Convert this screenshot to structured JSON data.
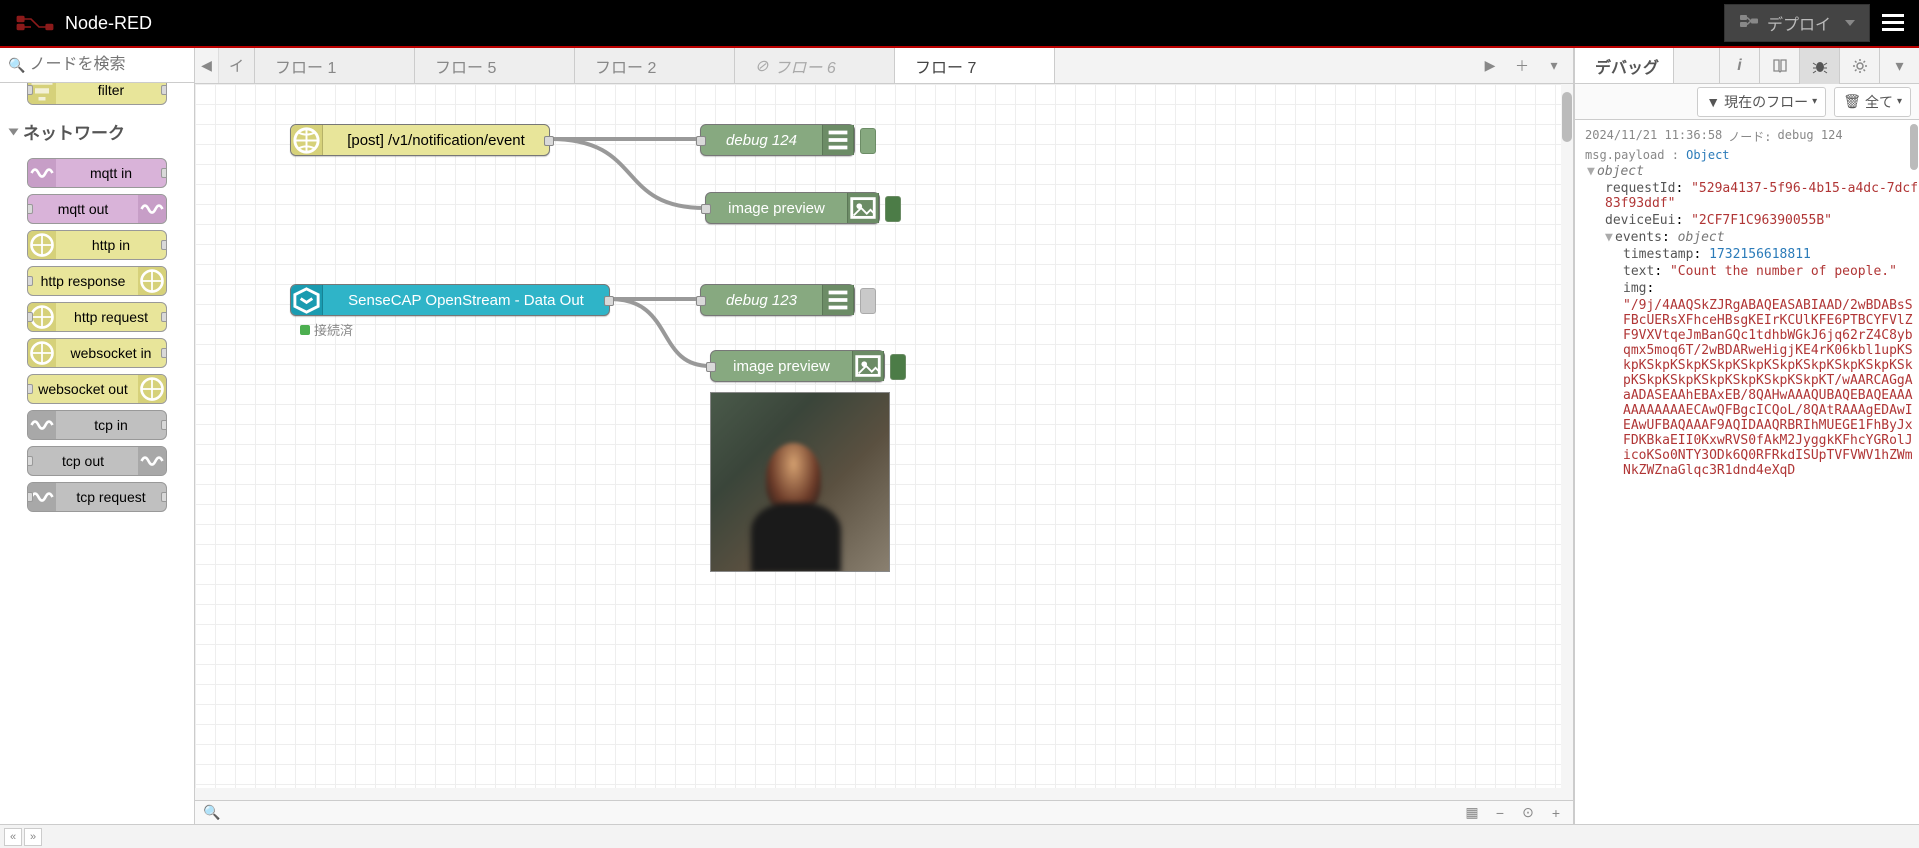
{
  "header": {
    "title": "Node-RED",
    "deploy_label": "デプロイ"
  },
  "palette": {
    "search_placeholder": "ノードを検索",
    "visible_top_item": "filter",
    "category": "ネットワーク",
    "nodes": [
      {
        "label": "mqtt in",
        "style": "purple",
        "in": false,
        "out": true,
        "icon": "wave"
      },
      {
        "label": "mqtt out",
        "style": "purple",
        "in": true,
        "out": false,
        "icon": "wave"
      },
      {
        "label": "http in",
        "style": "yellow",
        "in": false,
        "out": true,
        "icon": "globe"
      },
      {
        "label": "http response",
        "style": "yellow",
        "in": true,
        "out": false,
        "icon": "globe"
      },
      {
        "label": "http request",
        "style": "yellow",
        "in": true,
        "out": true,
        "icon": "globe"
      },
      {
        "label": "websocket in",
        "style": "yellow",
        "in": false,
        "out": true,
        "icon": "globe"
      },
      {
        "label": "websocket out",
        "style": "yellow",
        "in": true,
        "out": false,
        "icon": "globe"
      },
      {
        "label": "tcp in",
        "style": "grey",
        "in": false,
        "out": true,
        "icon": "wave"
      },
      {
        "label": "tcp out",
        "style": "grey",
        "in": true,
        "out": false,
        "icon": "wave"
      },
      {
        "label": "tcp request",
        "style": "grey",
        "in": true,
        "out": true,
        "icon": "wave"
      }
    ]
  },
  "workspace": {
    "truncated_tab": "イ",
    "tabs": [
      {
        "label": "フロー 1",
        "active": false
      },
      {
        "label": "フロー 5",
        "active": false
      },
      {
        "label": "フロー 2",
        "active": false
      },
      {
        "label": "フロー 6",
        "active": false,
        "disabled": true
      },
      {
        "label": "フロー 7",
        "active": true
      }
    ],
    "nodes": {
      "http_in": {
        "label": "[post] /v1/notification/event"
      },
      "debug124": {
        "label": "debug 124"
      },
      "image_preview1": {
        "label": "image preview"
      },
      "sensecap": {
        "label": "SenseCAP OpenStream - Data Out",
        "status": "接続済"
      },
      "debug123": {
        "label": "debug 123"
      },
      "image_preview2": {
        "label": "image preview"
      }
    }
  },
  "debug": {
    "tab_label": "デバッグ",
    "filter_label": "現在のフロー",
    "clear_label": "全て",
    "message": {
      "timestamp": "2024/11/21 11:36:58",
      "node_prefix": "ノード:",
      "node": "debug 124",
      "path": "msg.payload : Object",
      "root_type": "object",
      "requestId": "\"529a4137-5f96-4b15-a4dc-7dcf83f93ddf\"",
      "deviceEui": "\"2CF7F1C96390055B\"",
      "events_type": "object",
      "events_timestamp": "1732156618811",
      "events_text": "\"Count the number of people.\"",
      "events_img": "\"/9j/4AAQSkZJRgABAQEASABIAAD/2wBDABsSFBcUERsXFhceHBsgKEIrKCUlKFE6PTBCYFVlZF9VXVtqeJmBanGQc1tdhbWGkJ6jq62rZ4C8ybqmx5moq6T/2wBDARweHigjKE4rK06kbl1upKSkpKSkpKSkpKSkpKSkpKSkpKSkpKSkpKSkpKSkpKSkpKSkpKSkpKSkpKSkpKSkpKT/wAARCAGgAaADASEAAhEBAxEB/8QAHwAAAQUBAQEBAQEAAAAAAAAAAAECAwQFBgcICQoL/8QAtRAAAgEDAwIEAwUFBAQAAAF9AQIDAAQRBRIhMUEGE1FhByJxFDKBkaEII0KxwRVS0fAkM2JyggkKFhcYGRolJicoKSo0NTY3ODk6Q0RFRkdISUpTVFVWV1hZWmNkZWZnaGlqc3R1dnd4eXqD"
    }
  }
}
